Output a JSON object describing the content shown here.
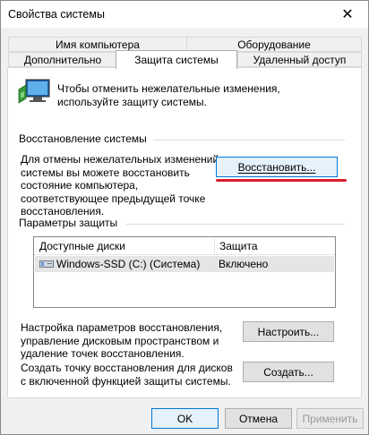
{
  "window": {
    "title": "Свойства системы"
  },
  "tabs": {
    "back": [
      "Имя компьютера",
      "Оборудование"
    ],
    "front": [
      "Дополнительно",
      "Защита системы",
      "Удаленный доступ"
    ],
    "selected": "Защита системы"
  },
  "intro": {
    "text": "Чтобы отменить нежелательные изменения, используйте защиту системы."
  },
  "restore": {
    "group_label": "Восстановление системы",
    "description": "Для отмены нежелательных изменений системы вы можете восстановить состояние компьютера, соответствующее предыдущей точке восстановления.",
    "button_label": "Восстановить..."
  },
  "protection": {
    "group_label": "Параметры защиты",
    "columns": [
      "Доступные диски",
      "Защита"
    ],
    "rows": [
      {
        "drive": "Windows-SSD (C:) (Система)",
        "status": "Включено"
      }
    ],
    "configure_description": "Настройка параметров восстановления, управление дисковым пространством и удаление точек восстановления.",
    "configure_label": "Настроить...",
    "create_description": "Создать точку восстановления для дисков с включенной функцией защиты системы.",
    "create_label": "Создать..."
  },
  "buttons": {
    "ok": "OK",
    "cancel": "Отмена",
    "apply": "Применить"
  },
  "colors": {
    "accent": "#0078d7",
    "highlight_underline": "#d81e2a"
  }
}
